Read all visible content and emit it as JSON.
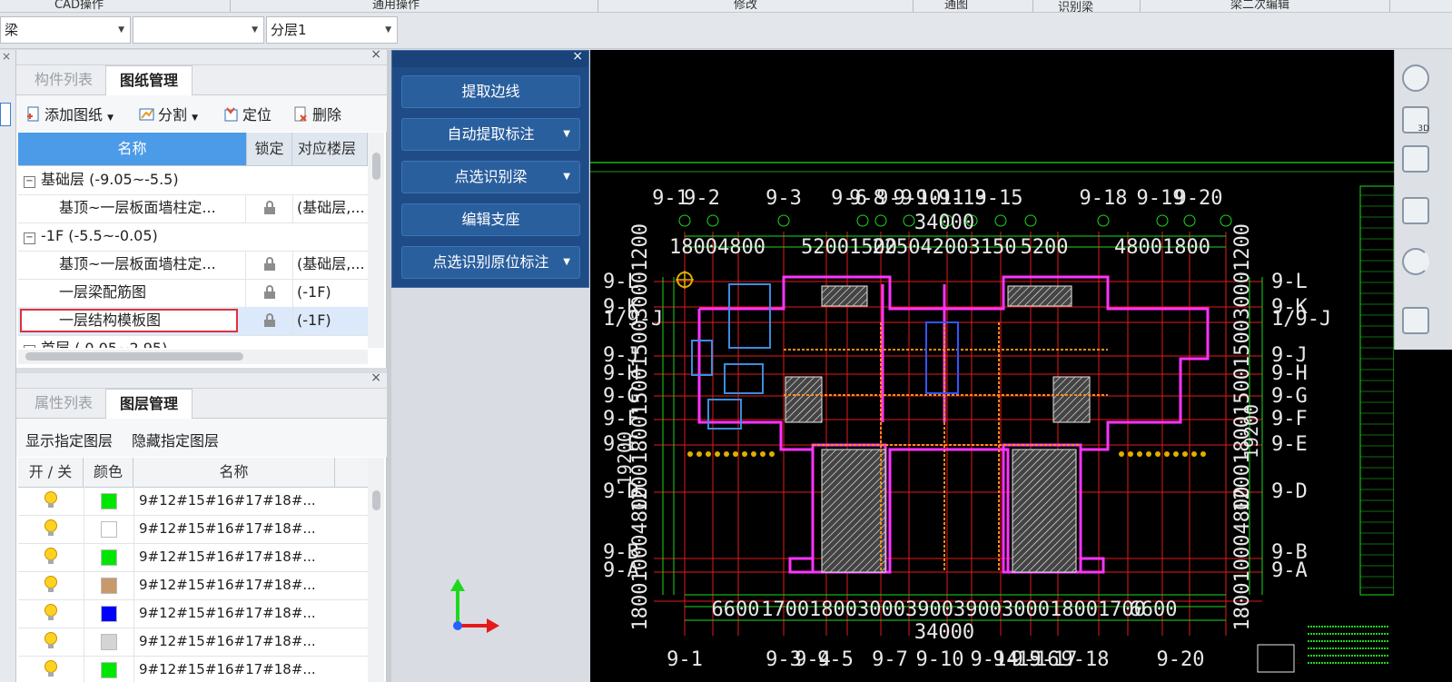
{
  "ribbon": {
    "groups": [
      "CAD操作",
      "通用操作",
      "修改",
      "通图",
      "识别梁",
      "梁二次编辑"
    ]
  },
  "selectors": {
    "type": "梁",
    "sub": "",
    "layer": "分层1"
  },
  "drawing_panel": {
    "tabs": [
      "构件列表",
      "图纸管理"
    ],
    "toolbar": {
      "add": "添加图纸",
      "split": "分割",
      "locate": "定位",
      "delete": "删除"
    },
    "columns": [
      "名称",
      "锁定",
      "对应楼层"
    ],
    "rows": [
      {
        "name": "基础层 (-9.05~-5.5)",
        "group": true,
        "toggle": "−",
        "lock": false,
        "floor": ""
      },
      {
        "name": "基顶~一层板面墙柱定...",
        "group": false,
        "lock": true,
        "floor": "(基础层,..."
      },
      {
        "name": "-1F (-5.5~-0.05)",
        "group": true,
        "toggle": "−",
        "lock": false,
        "floor": ""
      },
      {
        "name": "基顶~一层板面墙柱定...",
        "group": false,
        "lock": true,
        "floor": "(基础层,..."
      },
      {
        "name": "一层梁配筋图",
        "group": false,
        "lock": true,
        "floor": "(-1F)"
      },
      {
        "name": "一层结构模板图",
        "group": false,
        "lock": true,
        "floor": "(-1F)",
        "selected": true
      },
      {
        "name": "首层 ( 0.05~2.95)",
        "group": true,
        "toggle": "−",
        "lock": false,
        "floor": ""
      }
    ]
  },
  "layer_panel": {
    "tabs": [
      "属性列表",
      "图层管理"
    ],
    "show_label": "显示指定图层",
    "hide_label": "隐藏指定图层",
    "columns": [
      "开 / 关",
      "颜色",
      "名称"
    ],
    "rows": [
      {
        "color": "#00e600",
        "name": "9#12#15#16#17#18#..."
      },
      {
        "color": "#ffffff",
        "name": "9#12#15#16#17#18#..."
      },
      {
        "color": "#00e600",
        "name": "9#12#15#16#17#18#..."
      },
      {
        "color": "#c8996a",
        "name": "9#12#15#16#17#18#..."
      },
      {
        "color": "#0000ff",
        "name": "9#12#15#16#17#18#..."
      },
      {
        "color": "#d4d4d4",
        "name": "9#12#15#16#17#18#..."
      },
      {
        "color": "#00e600",
        "name": "9#12#15#16#17#18#..."
      }
    ]
  },
  "dialog": {
    "buttons": [
      {
        "label": "提取边线",
        "dropdown": false
      },
      {
        "label": "自动提取标注",
        "dropdown": true
      },
      {
        "label": "点选识别梁",
        "dropdown": true
      },
      {
        "label": "编辑支座",
        "dropdown": false
      },
      {
        "label": "点选识别原位标注",
        "dropdown": true
      }
    ]
  },
  "cad": {
    "top_axes": [
      "9-1",
      "9-2",
      "9-3",
      "9-6",
      "9-8",
      "9-9",
      "9-10",
      "9-11",
      "9-13",
      "9-15",
      "9-18",
      "9-19",
      "9-20"
    ],
    "top_total": "34000",
    "top_dims": [
      "1800",
      "4800",
      "5200",
      "1500",
      "2250",
      "4200",
      "3150",
      "5200",
      "4800",
      "1800"
    ],
    "bottom_dims": [
      "6600",
      "1700",
      "1800",
      "3000",
      "3900",
      "3900",
      "3000",
      "1800",
      "1700",
      "6600"
    ],
    "bottom_total": "34000",
    "bottom_axes": [
      "9-1",
      "9-3",
      "9-4",
      "9-5",
      "9-7",
      "9-10",
      "9-14",
      "9-15",
      "9-16",
      "9-17",
      "9-18",
      "9-20"
    ],
    "left_axes": [
      "9-L",
      "9-K",
      "1/9-J",
      "9-J",
      "9-H",
      "9-G",
      "9-F",
      "9-E",
      "9-D",
      "9-B",
      "9-A"
    ],
    "right_axes": [
      "9-L",
      "9-K",
      "1/9-J",
      "9-J",
      "9-H",
      "9-G",
      "9-F",
      "9-E",
      "9-D",
      "9-B",
      "9-A"
    ],
    "side_dims": [
      "1200",
      "1800",
      "1500",
      "1500",
      "3000",
      "1200",
      "1800",
      "1000",
      "4800"
    ],
    "side_total": "19200",
    "ucs_y": "Y",
    "ucs_x": "X"
  },
  "right_toolbar": {
    "icons": [
      "orbit-icon",
      "3d-view-icon",
      "box-view-icon",
      "face-view-icon",
      "rotate-icon",
      "grid-icon"
    ],
    "labels": [
      "3D"
    ]
  }
}
